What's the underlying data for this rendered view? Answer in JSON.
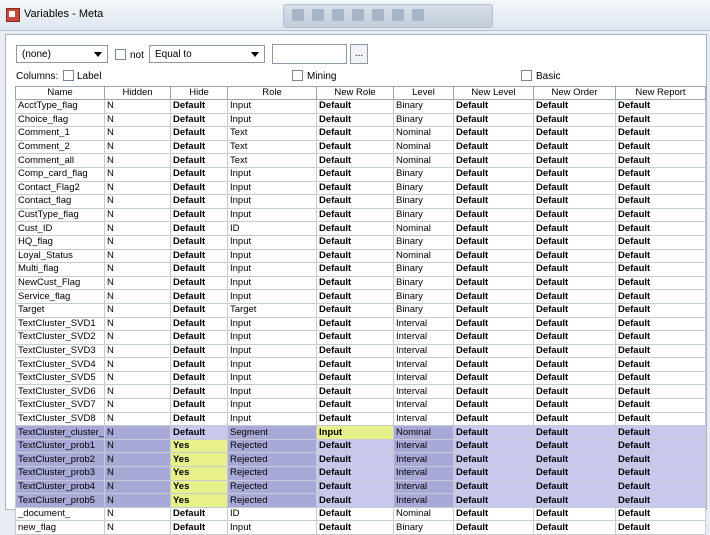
{
  "window": {
    "title": "Variables - Meta"
  },
  "filter": {
    "field": "(none)",
    "not_label": "not",
    "operator": "Equal to",
    "value": "",
    "browse_label": "..."
  },
  "columns": {
    "label": "Columns:",
    "label_chk": "Label",
    "mining_chk": "Mining",
    "basic_chk": "Basic"
  },
  "headers": [
    "Name",
    "Hidden",
    "Hide",
    "Role",
    "New Role",
    "Level",
    "New Level",
    "New Order",
    "New Report"
  ],
  "rows": [
    [
      "AcctType_flag",
      "N",
      "Default",
      "Input",
      "Default",
      "Binary",
      "Default",
      "Default",
      "Default"
    ],
    [
      "Choice_flag",
      "N",
      "Default",
      "Input",
      "Default",
      "Binary",
      "Default",
      "Default",
      "Default"
    ],
    [
      "Comment_1",
      "N",
      "Default",
      "Text",
      "Default",
      "Nominal",
      "Default",
      "Default",
      "Default"
    ],
    [
      "Comment_2",
      "N",
      "Default",
      "Text",
      "Default",
      "Nominal",
      "Default",
      "Default",
      "Default"
    ],
    [
      "Comment_all",
      "N",
      "Default",
      "Text",
      "Default",
      "Nominal",
      "Default",
      "Default",
      "Default"
    ],
    [
      "Comp_card_flag",
      "N",
      "Default",
      "Input",
      "Default",
      "Binary",
      "Default",
      "Default",
      "Default"
    ],
    [
      "Contact_Flag2",
      "N",
      "Default",
      "Input",
      "Default",
      "Binary",
      "Default",
      "Default",
      "Default"
    ],
    [
      "Contact_flag",
      "N",
      "Default",
      "Input",
      "Default",
      "Binary",
      "Default",
      "Default",
      "Default"
    ],
    [
      "CustType_flag",
      "N",
      "Default",
      "Input",
      "Default",
      "Binary",
      "Default",
      "Default",
      "Default"
    ],
    [
      "Cust_ID",
      "N",
      "Default",
      "ID",
      "Default",
      "Nominal",
      "Default",
      "Default",
      "Default"
    ],
    [
      "HQ_flag",
      "N",
      "Default",
      "Input",
      "Default",
      "Binary",
      "Default",
      "Default",
      "Default"
    ],
    [
      "Loyal_Status",
      "N",
      "Default",
      "Input",
      "Default",
      "Nominal",
      "Default",
      "Default",
      "Default"
    ],
    [
      "Multi_flag",
      "N",
      "Default",
      "Input",
      "Default",
      "Binary",
      "Default",
      "Default",
      "Default"
    ],
    [
      "NewCust_Flag",
      "N",
      "Default",
      "Input",
      "Default",
      "Binary",
      "Default",
      "Default",
      "Default"
    ],
    [
      "Service_flag",
      "N",
      "Default",
      "Input",
      "Default",
      "Binary",
      "Default",
      "Default",
      "Default"
    ],
    [
      "Target",
      "N",
      "Default",
      "Target",
      "Default",
      "Binary",
      "Default",
      "Default",
      "Default"
    ],
    [
      "TextCluster_SVD1",
      "N",
      "Default",
      "Input",
      "Default",
      "Interval",
      "Default",
      "Default",
      "Default"
    ],
    [
      "TextCluster_SVD2",
      "N",
      "Default",
      "Input",
      "Default",
      "Interval",
      "Default",
      "Default",
      "Default"
    ],
    [
      "TextCluster_SVD3",
      "N",
      "Default",
      "Input",
      "Default",
      "Interval",
      "Default",
      "Default",
      "Default"
    ],
    [
      "TextCluster_SVD4",
      "N",
      "Default",
      "Input",
      "Default",
      "Interval",
      "Default",
      "Default",
      "Default"
    ],
    [
      "TextCluster_SVD5",
      "N",
      "Default",
      "Input",
      "Default",
      "Interval",
      "Default",
      "Default",
      "Default"
    ],
    [
      "TextCluster_SVD6",
      "N",
      "Default",
      "Input",
      "Default",
      "Interval",
      "Default",
      "Default",
      "Default"
    ],
    [
      "TextCluster_SVD7",
      "N",
      "Default",
      "Input",
      "Default",
      "Interval",
      "Default",
      "Default",
      "Default"
    ],
    [
      "TextCluster_SVD8",
      "N",
      "Default",
      "Input",
      "Default",
      "Interval",
      "Default",
      "Default",
      "Default"
    ],
    [
      "TextCluster_cluster_",
      "N",
      "Default",
      "Segment",
      "Input",
      "Nominal",
      "Default",
      "Default",
      "Default"
    ],
    [
      "TextCluster_prob1",
      "N",
      "Yes",
      "Rejected",
      "Default",
      "Interval",
      "Default",
      "Default",
      "Default"
    ],
    [
      "TextCluster_prob2",
      "N",
      "Yes",
      "Rejected",
      "Default",
      "Interval",
      "Default",
      "Default",
      "Default"
    ],
    [
      "TextCluster_prob3",
      "N",
      "Yes",
      "Rejected",
      "Default",
      "Interval",
      "Default",
      "Default",
      "Default"
    ],
    [
      "TextCluster_prob4",
      "N",
      "Yes",
      "Rejected",
      "Default",
      "Interval",
      "Default",
      "Default",
      "Default"
    ],
    [
      "TextCluster_prob5",
      "N",
      "Yes",
      "Rejected",
      "Default",
      "Interval",
      "Default",
      "Default",
      "Default"
    ],
    [
      "_document_",
      "N",
      "Default",
      "ID",
      "Default",
      "Nominal",
      "Default",
      "Default",
      "Default"
    ],
    [
      "new_flag",
      "N",
      "Default",
      "Input",
      "Default",
      "Binary",
      "Default",
      "Default",
      "Default"
    ]
  ],
  "selected_rows": [
    24,
    25,
    26,
    27,
    28,
    29
  ],
  "highlighted_cells": [
    [
      24,
      4
    ],
    [
      25,
      2
    ],
    [
      26,
      2
    ],
    [
      27,
      2
    ],
    [
      28,
      2
    ],
    [
      29,
      2
    ]
  ],
  "colors": {
    "selection": "#c8c8ef",
    "highlight": "#e8f08b",
    "readonly": "#d7d7d7"
  }
}
